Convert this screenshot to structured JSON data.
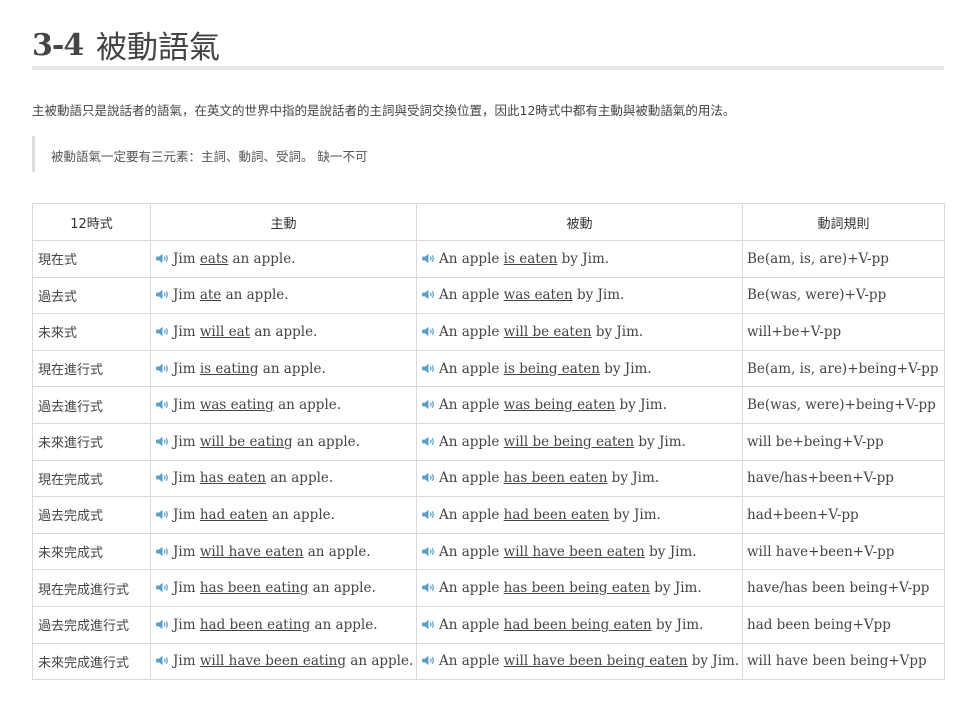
{
  "heading": {
    "number": "3-4",
    "title": "被動語氣"
  },
  "intro": "主被動語只是說話者的語氣，在英文的世界中指的是說話者的主詞與受詞交換位置，因此12時式中都有主動與被動語氣的用法。",
  "note": "被動語氣一定要有三元素：主詞、動詞、受詞。 缺一不可",
  "table": {
    "headers": [
      "12時式",
      "主動",
      "被動",
      "動詞規則"
    ],
    "rows": [
      {
        "tense": "現在式",
        "active": [
          "Jim ",
          "eats",
          " an apple."
        ],
        "passive": [
          "An apple ",
          "is eaten",
          " by Jim."
        ],
        "rule": "Be(am, is, are)+V-pp"
      },
      {
        "tense": "過去式",
        "active": [
          "Jim ",
          "ate",
          " an apple."
        ],
        "passive": [
          "An apple ",
          "was eaten",
          " by Jim."
        ],
        "rule": "Be(was, were)+V-pp"
      },
      {
        "tense": "未來式",
        "active": [
          "Jim ",
          "will eat",
          " an apple."
        ],
        "passive": [
          "An apple ",
          "will be eaten",
          " by Jim."
        ],
        "rule": "will+be+V-pp"
      },
      {
        "tense": "現在進行式",
        "active": [
          "Jim ",
          "is eating",
          " an apple."
        ],
        "passive": [
          "An apple ",
          "is being eaten",
          " by Jim."
        ],
        "rule": "Be(am, is, are)+being+V-pp"
      },
      {
        "tense": "過去進行式",
        "active": [
          "Jim ",
          "was eating",
          " an apple."
        ],
        "passive": [
          "An apple ",
          "was being eaten",
          " by Jim."
        ],
        "rule": "Be(was, were)+being+V-pp"
      },
      {
        "tense": "未來進行式",
        "active": [
          "Jim ",
          "will be eating",
          " an apple."
        ],
        "passive": [
          "An apple ",
          "will be being eaten",
          " by Jim."
        ],
        "rule": "will be+being+V-pp"
      },
      {
        "tense": "現在完成式",
        "active": [
          "Jim ",
          "has eaten",
          " an apple."
        ],
        "passive": [
          "An apple ",
          "has been eaten",
          " by Jim."
        ],
        "rule": "have/has+been+V-pp"
      },
      {
        "tense": "過去完成式",
        "active": [
          "Jim ",
          "had eaten",
          " an apple."
        ],
        "passive": [
          "An apple ",
          "had been eaten",
          " by Jim."
        ],
        "rule": "had+been+V-pp"
      },
      {
        "tense": "未來完成式",
        "active": [
          "Jim ",
          "will have eaten",
          " an apple."
        ],
        "passive": [
          "An apple ",
          "will have been eaten",
          " by Jim."
        ],
        "rule": "will have+been+V-pp"
      },
      {
        "tense": "現在完成進行式",
        "active": [
          "Jim ",
          "has been eating",
          " an apple."
        ],
        "passive": [
          "An apple ",
          "has been being eaten",
          " by Jim."
        ],
        "rule": "have/has been being+V-pp"
      },
      {
        "tense": "過去完成進行式",
        "active": [
          "Jim ",
          "had been eating",
          " an apple."
        ],
        "passive": [
          "An apple ",
          "had been being eaten",
          " by Jim."
        ],
        "rule": "had been being+Vpp"
      },
      {
        "tense": "未來完成進行式",
        "active": [
          "Jim ",
          "will have been eating",
          " an apple."
        ],
        "passive": [
          "An apple ",
          "will have been being eaten",
          " by Jim."
        ],
        "rule": "will have been being+Vpp"
      }
    ]
  },
  "icons": {
    "speaker": "speaker-icon"
  },
  "colors": {
    "speaker": "#5aa0c8",
    "border": "#d9d9d9",
    "divider": "#e6e6e6"
  }
}
